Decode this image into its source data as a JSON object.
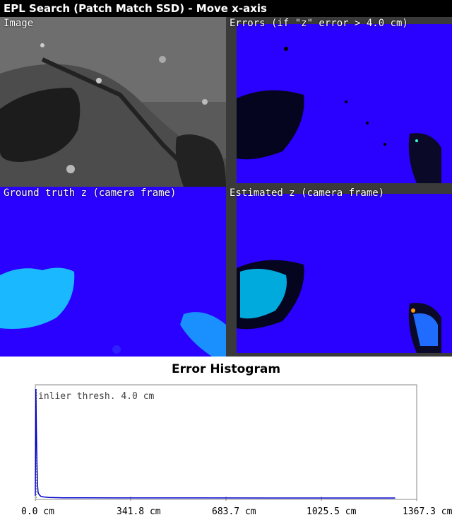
{
  "window": {
    "title": "EPL Search (Patch Match SSD) - Move x-axis"
  },
  "panels": {
    "image": {
      "label": "Image"
    },
    "errors": {
      "label": "Errors (if \"z\" error > 4.0 cm)"
    },
    "ground_truth": {
      "label": "Ground truth z (camera frame)"
    },
    "estimated": {
      "label": "Estimated z (camera frame)"
    }
  },
  "colors": {
    "depth_blue": "#2a00ff",
    "rock_cyan": "#00c8ff",
    "rock_gt": "#1ab8ff",
    "histogram_line": "#0000c8"
  },
  "histogram": {
    "title": "Error Histogram",
    "threshold_label": "inlier thresh. 4.0 cm",
    "tick_labels": [
      "0.0 cm",
      "341.8 cm",
      "683.7 cm",
      "1025.5 cm",
      "1367.3 cm"
    ]
  },
  "chart_data": {
    "type": "line",
    "title": "Error Histogram",
    "xlabel": "",
    "ylabel": "",
    "xlim": [
      0.0,
      1367.3
    ],
    "x_ticks": [
      0.0,
      341.8,
      683.7,
      1025.5,
      1367.3
    ],
    "threshold": 4.0,
    "x": [
      0,
      2,
      4,
      6,
      8,
      10,
      14,
      20,
      30,
      50,
      100,
      300,
      600,
      900,
      1200,
      1290
    ],
    "values": [
      0.02,
      1.0,
      0.6,
      0.3,
      0.12,
      0.05,
      0.03,
      0.015,
      0.01,
      0.005,
      0.002,
      0.001,
      0.0005,
      0.0003,
      0.0002,
      0.0
    ]
  }
}
